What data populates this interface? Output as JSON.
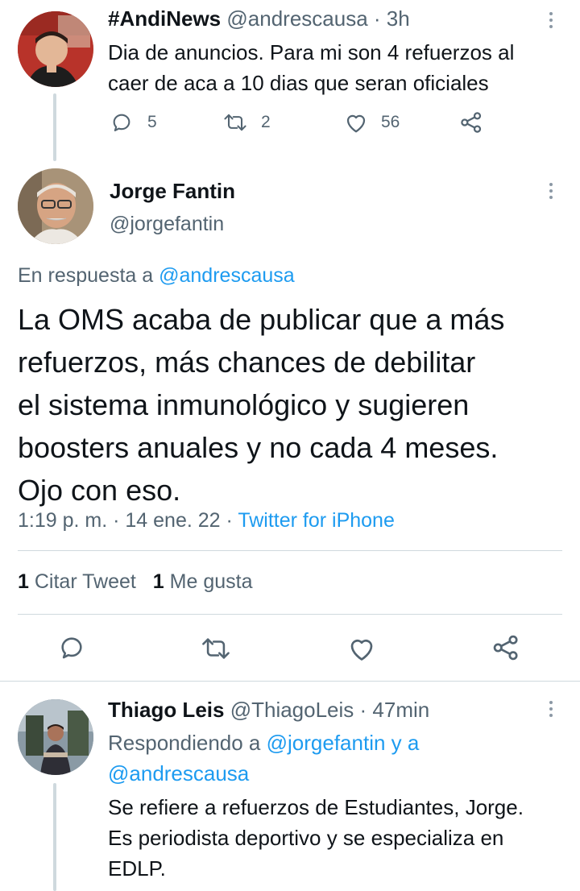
{
  "tweet1": {
    "display_name": "#AndiNews",
    "handle": "@andrescausa",
    "time": "· 3h",
    "text_line1": "Dia de anuncios. Para mi son 4 refuerzos al",
    "text_line2": "caer de aca a 10 dias que seran oficiales",
    "reply_count": "5",
    "retweet_count": "2",
    "like_count": "56"
  },
  "main_tweet": {
    "display_name": "Jorge Fantin",
    "handle": "@jorgefantin",
    "reply_prefix": "En respuesta a",
    "reply_target": "@andrescausa",
    "text_lines": [
      "La OMS acaba de publicar que a más",
      "refuerzos, más chances de debilitar",
      "el sistema inmunológico y sugieren",
      "boosters anuales y no cada 4 meses.",
      "Ojo con eso."
    ],
    "timestamp": "1:19 p. m. · 14 ene. 22 ·",
    "source": "Twitter for iPhone",
    "quote_count": "1",
    "quote_label": "Citar Tweet",
    "like_count": "1",
    "like_label": "Me gusta"
  },
  "reply_tweet": {
    "display_name": "Thiago Leis",
    "handle": "@ThiagoLeis",
    "time": "· 47min",
    "replying_prefix": "Respondiendo a",
    "replying_target1": "@jorgefantin y a",
    "replying_target2": "@andrescausa",
    "text_lines": [
      "Se refiere a refuerzos de Estudiantes, Jorge.",
      "Es periodista deportivo y se especializa en",
      "EDLP."
    ]
  },
  "colors": {
    "accent": "#1d9bf0",
    "muted": "#536471",
    "text": "#0f1419",
    "divider": "#cfd9de"
  },
  "icons": [
    "reply-icon",
    "retweet-icon",
    "like-icon",
    "share-icon",
    "more-icon"
  ]
}
